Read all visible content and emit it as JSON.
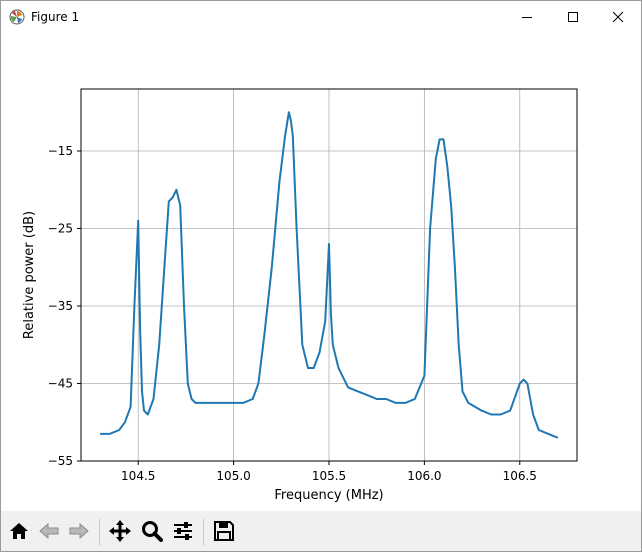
{
  "window": {
    "title": "Figure 1",
    "icon": "matplotlib-icon",
    "controls": [
      "minimize-icon",
      "maximize-icon",
      "close-icon"
    ]
  },
  "toolbar": {
    "buttons": [
      {
        "name": "home-button",
        "icon": "home-icon",
        "enabled": true
      },
      {
        "name": "back-button",
        "icon": "arrow-left-icon",
        "enabled": false
      },
      {
        "name": "forward-button",
        "icon": "arrow-right-icon",
        "enabled": false
      },
      {
        "name": "pan-button",
        "icon": "move-icon",
        "enabled": true
      },
      {
        "name": "zoom-button",
        "icon": "magnifier-icon",
        "enabled": true
      },
      {
        "name": "configure-subplots-button",
        "icon": "sliders-icon",
        "enabled": true
      },
      {
        "name": "save-button",
        "icon": "floppy-disk-icon",
        "enabled": true
      }
    ]
  },
  "chart_data": {
    "type": "line",
    "title": "",
    "xlabel": "Frequency (MHz)",
    "ylabel": "Relative power (dB)",
    "xlim": [
      104.2,
      106.8
    ],
    "ylim": [
      -55,
      -7
    ],
    "xticks": [
      104.5,
      105.0,
      105.5,
      106.0,
      106.5
    ],
    "xtick_labels": [
      "104.5",
      "105.0",
      "105.5",
      "106.0",
      "106.5"
    ],
    "yticks": [
      -55,
      -45,
      -35,
      -25,
      -15
    ],
    "ytick_labels": [
      "−55",
      "−45",
      "−35",
      "−25",
      "−15"
    ],
    "grid": true,
    "legend": false,
    "color": "#1f77b4",
    "series": [
      {
        "x": [
          104.3,
          104.35,
          104.4,
          104.43,
          104.46,
          104.48,
          104.5,
          104.51,
          104.52,
          104.53,
          104.55,
          104.58,
          104.61,
          104.64,
          104.66,
          104.68,
          104.7,
          104.72,
          104.74,
          104.76,
          104.78,
          104.8,
          104.85,
          104.9,
          104.95,
          105.0,
          105.05,
          105.1,
          105.13,
          105.16,
          105.2,
          105.24,
          105.27,
          105.29,
          105.3,
          105.31,
          105.33,
          105.36,
          105.39,
          105.42,
          105.45,
          105.48,
          105.5,
          105.51,
          105.52,
          105.55,
          105.6,
          105.65,
          105.7,
          105.75,
          105.8,
          105.85,
          105.9,
          105.95,
          106.0,
          106.03,
          106.06,
          106.08,
          106.1,
          106.12,
          106.14,
          106.16,
          106.18,
          106.2,
          106.23,
          106.3,
          106.35,
          106.4,
          106.45,
          106.5,
          106.52,
          106.54,
          106.57,
          106.6,
          106.65,
          106.7
        ],
        "y": [
          -51.5,
          -51.5,
          -51,
          -50,
          -48,
          -35,
          -24,
          -38,
          -46,
          -48.5,
          -49,
          -47,
          -40,
          -29,
          -21.5,
          -21,
          -20,
          -22,
          -35,
          -45,
          -47,
          -47.5,
          -47.5,
          -47.5,
          -47.5,
          -47.5,
          -47.5,
          -47,
          -45,
          -39,
          -30,
          -19,
          -13,
          -10,
          -11,
          -13,
          -25,
          -40,
          -43,
          -43,
          -41,
          -37,
          -27,
          -36,
          -40,
          -43,
          -45.5,
          -46,
          -46.5,
          -47,
          -47,
          -47.5,
          -47.5,
          -47,
          -44,
          -25,
          -16,
          -13.5,
          -13.5,
          -17,
          -22,
          -30,
          -40,
          -46,
          -47.5,
          -48.5,
          -49,
          -49,
          -48.5,
          -45,
          -44.5,
          -45,
          -49,
          -51,
          -51.5,
          -52
        ]
      }
    ]
  }
}
